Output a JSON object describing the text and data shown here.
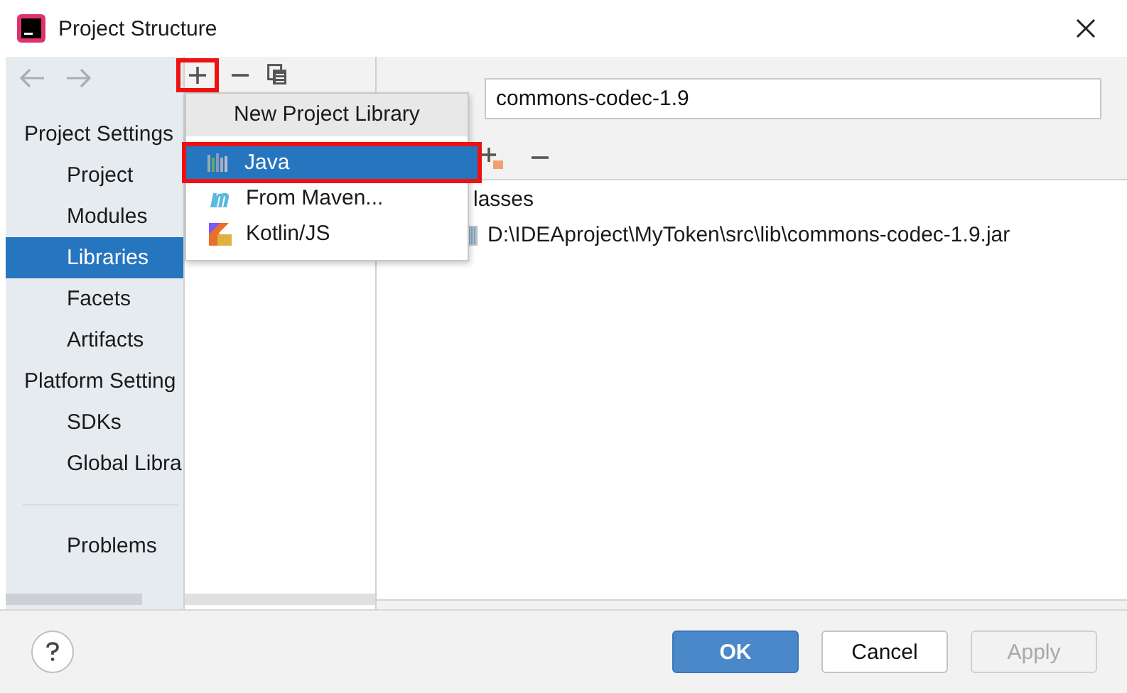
{
  "window": {
    "title": "Project Structure"
  },
  "sidebar": {
    "items": [
      {
        "kind": "header",
        "label": "Project Settings"
      },
      {
        "kind": "item",
        "label": "Project",
        "selected": false
      },
      {
        "kind": "item",
        "label": "Modules",
        "selected": false
      },
      {
        "kind": "item",
        "label": "Libraries",
        "selected": true
      },
      {
        "kind": "item",
        "label": "Facets",
        "selected": false
      },
      {
        "kind": "item",
        "label": "Artifacts",
        "selected": false
      },
      {
        "kind": "header",
        "label": "Platform Setting"
      },
      {
        "kind": "item",
        "label": "SDKs",
        "selected": false
      },
      {
        "kind": "item",
        "label": "Global Libra",
        "selected": false
      },
      {
        "kind": "separator"
      },
      {
        "kind": "item",
        "label": "Problems",
        "selected": false
      }
    ]
  },
  "library_toolbar": {
    "add_highlighted": true
  },
  "popup": {
    "title": "New Project Library",
    "items": [
      {
        "label": "Java",
        "selected": true,
        "highlighted": true
      },
      {
        "label": "From Maven...",
        "selected": false,
        "highlighted": false
      },
      {
        "label": "Kotlin/JS",
        "selected": false,
        "highlighted": false
      }
    ]
  },
  "details": {
    "name_value": "commons-codec-1.9",
    "tree": {
      "root": "lasses",
      "children": [
        {
          "label": "D:\\IDEAproject\\MyToken\\src\\lib\\commons-codec-1.9.jar"
        }
      ]
    }
  },
  "buttons": [
    {
      "kind": "primary",
      "label": "OK",
      "disabled": false
    },
    {
      "kind": "normal",
      "label": "Cancel",
      "disabled": false
    },
    {
      "kind": "normal",
      "label": "Apply",
      "disabled": true
    }
  ]
}
